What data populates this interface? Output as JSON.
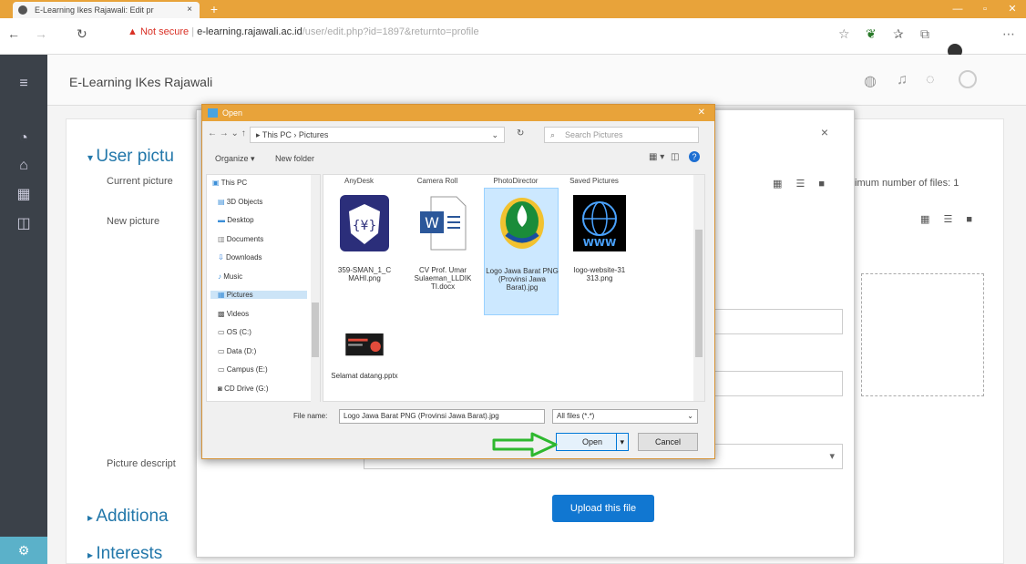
{
  "browser": {
    "tab_title": "E-Learning Ikes Rajawali: Edit pr",
    "tab_close": "×",
    "new_tab": "+",
    "not_secure": "Not secure",
    "url_host": "e-learning.rajawali.ac.id",
    "url_path": "/user/edit.php?id=1897&returnto=profile"
  },
  "site": {
    "name": "E-Learning IKes Rajawali"
  },
  "profile": {
    "section_user_picture": "User pictu",
    "current_picture_label": "Current picture",
    "new_picture_label": "New picture",
    "picture_description_label": "Picture descript",
    "section_additional": "Additiona",
    "section_interests": "Interests"
  },
  "file_picker": {
    "max_files_text": "imum number of files: 1",
    "upload_button": "Upload this file",
    "close": "×"
  },
  "dialog": {
    "title": "Open",
    "close": "✕",
    "breadcrumb": "▸ This PC  ›  Pictures",
    "search_placeholder": "Search Pictures",
    "organize": "Organize ▾",
    "new_folder": "New folder",
    "tree": [
      {
        "label": "This PC",
        "selected": false
      },
      {
        "label": "3D Objects",
        "selected": false
      },
      {
        "label": "Desktop",
        "selected": false
      },
      {
        "label": "Documents",
        "selected": false
      },
      {
        "label": "Downloads",
        "selected": false
      },
      {
        "label": "Music",
        "selected": false
      },
      {
        "label": "Pictures",
        "selected": true
      },
      {
        "label": "Videos",
        "selected": false
      },
      {
        "label": "OS (C:)",
        "selected": false
      },
      {
        "label": "Data (D:)",
        "selected": false
      },
      {
        "label": "Campus (E:)",
        "selected": false
      },
      {
        "label": "CD Drive (G:)",
        "selected": false
      }
    ],
    "folder_headers": [
      "AnyDesk",
      "Camera Roll",
      "PhotoDirector",
      "Saved Pictures"
    ],
    "files": [
      {
        "name": "359-SMAN_1_C MAHI.png",
        "kind": "logo-shield",
        "selected": false
      },
      {
        "name": "CV Prof. Umar Sulaeman_LLDIK TI.docx",
        "kind": "word-doc",
        "selected": false
      },
      {
        "name": "Logo Jawa Barat PNG (Provinsi Jawa Barat).jpg",
        "kind": "logo-jabar",
        "selected": true
      },
      {
        "name": "logo-website-31 313.png",
        "kind": "logo-www",
        "selected": false
      },
      {
        "name": "Selamat datang.pptx",
        "kind": "slide",
        "selected": false
      }
    ],
    "file_name_label": "File name:",
    "file_name_value": "Logo Jawa Barat PNG (Provinsi Jawa Barat).jpg",
    "file_type": "All files (*.*)",
    "open_button": "Open",
    "cancel_button": "Cancel"
  },
  "colors": {
    "accent_orange": "#e8a33a",
    "link_blue": "#2277aa",
    "upload_blue": "#1177d1",
    "arrow_green": "#2eb82e"
  }
}
